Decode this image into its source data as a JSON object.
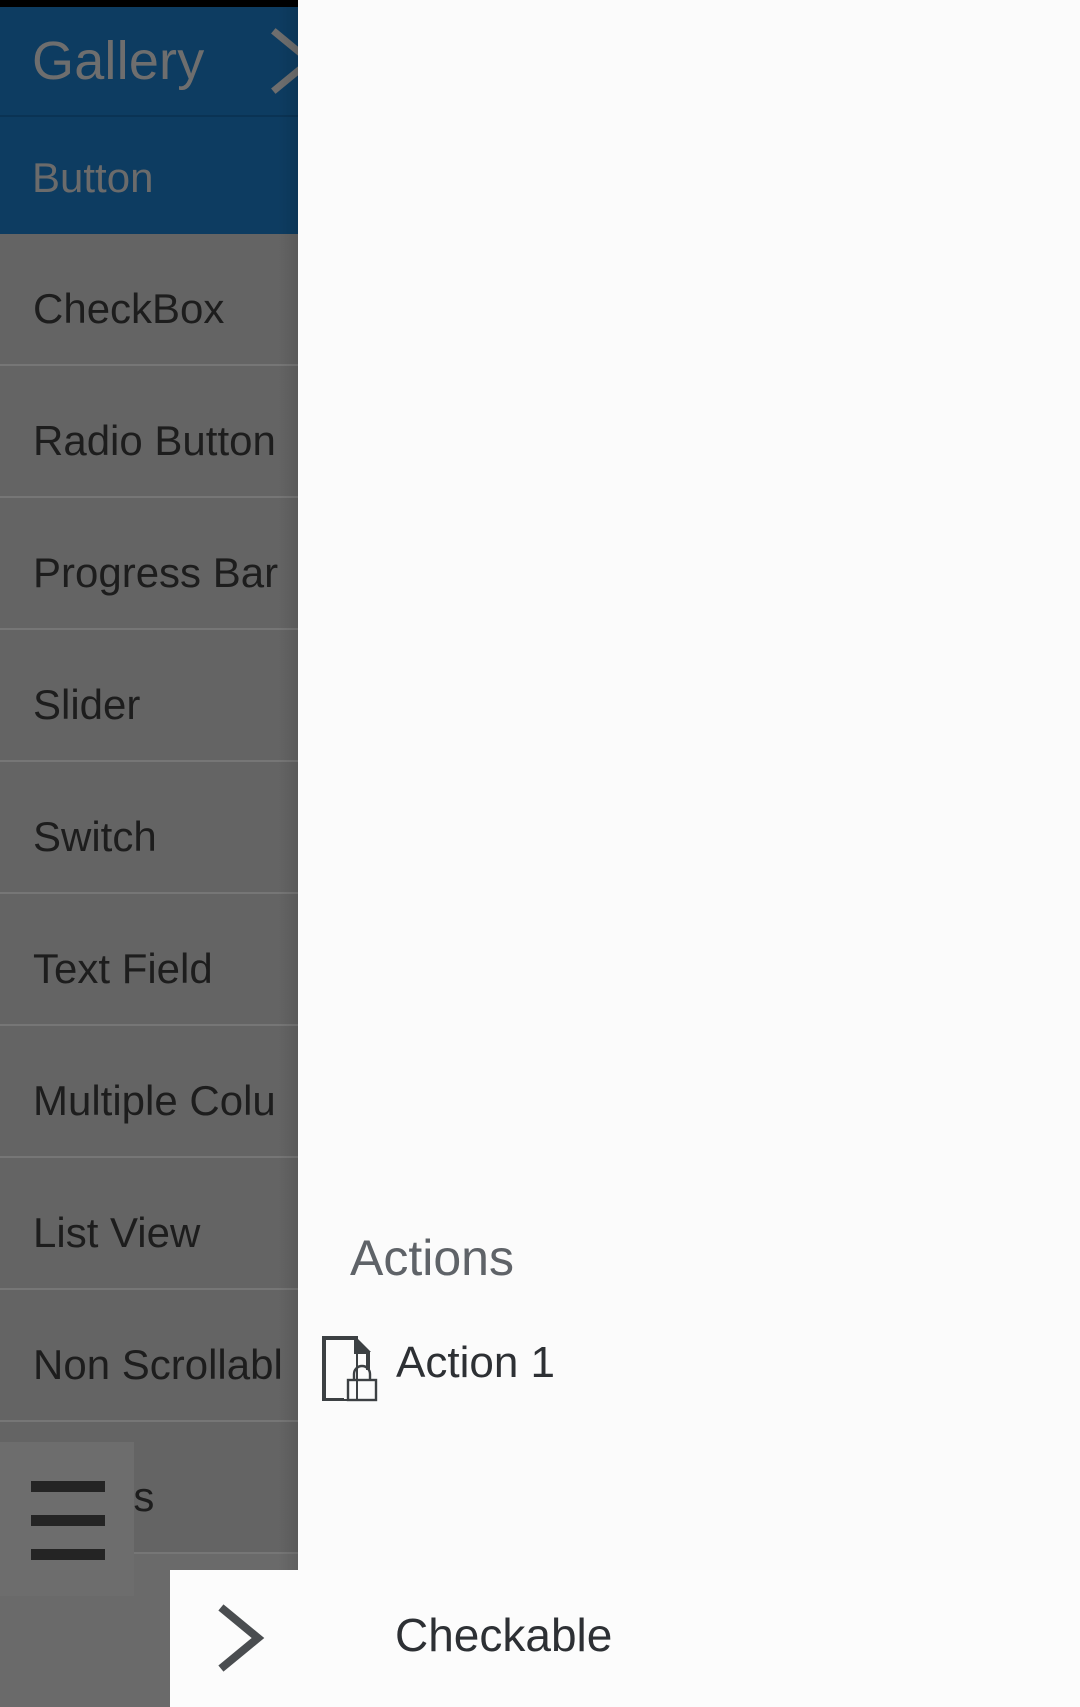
{
  "app": {
    "drawer": {
      "header": {
        "title": "Gallery",
        "chevron_icon": "chevron-right-icon"
      },
      "selected_item": {
        "label": "Button"
      },
      "items": [
        {
          "label": "CheckBox"
        },
        {
          "label": "Radio Button"
        },
        {
          "label": "Progress Bar"
        },
        {
          "label": "Slider"
        },
        {
          "label": "Switch"
        },
        {
          "label": "Text Field"
        },
        {
          "label": "Multiple Colu"
        },
        {
          "label": "List View"
        },
        {
          "label": "Non Scrollabl"
        },
        {
          "label": "Colors"
        }
      ]
    },
    "menu_button": {
      "icon": "hamburger-menu-icon"
    },
    "actions_panel": {
      "title": "Actions",
      "items": [
        {
          "label": "Action 1",
          "icon": "document-lock-icon"
        }
      ]
    },
    "checkable_card": {
      "label": "Checkable",
      "icon": "chevron-right-icon"
    },
    "colors": {
      "primary_blue": "#0d3c61",
      "scrim_gray": "#646464",
      "surface": "#fbfbfb",
      "text_dark": "#1d1d1d",
      "text_muted": "#5f6368",
      "drawer_title_text": "#6e6e6e"
    }
  }
}
